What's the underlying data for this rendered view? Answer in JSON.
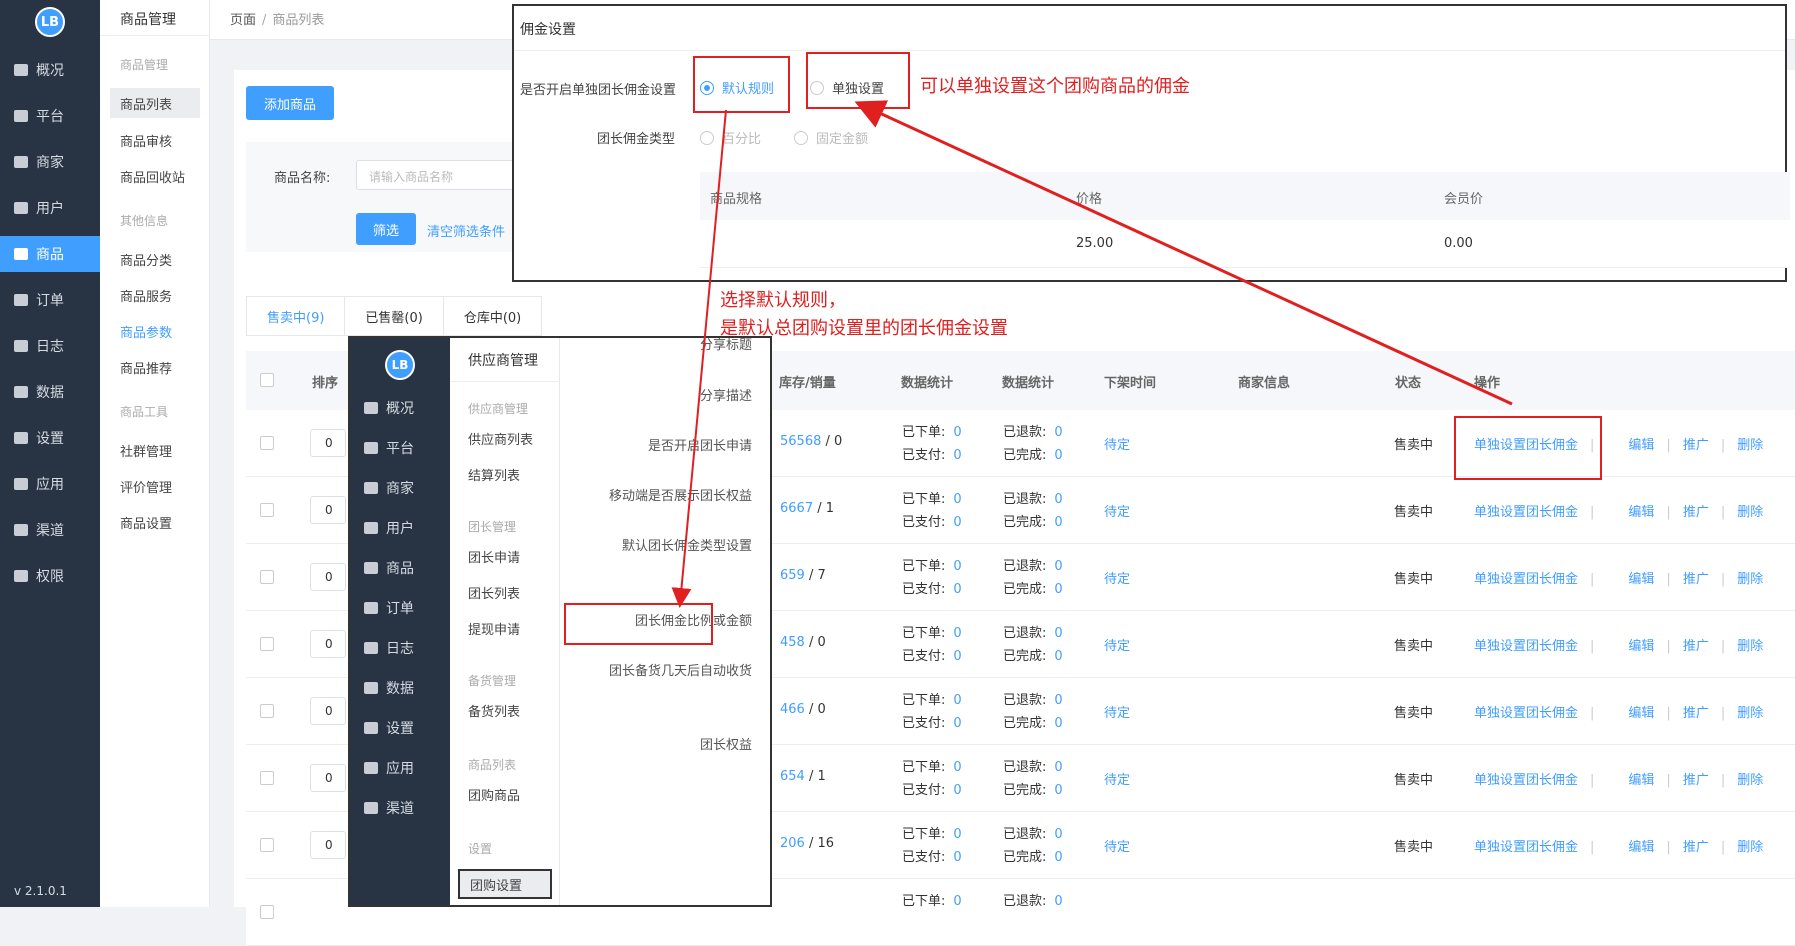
{
  "sidebar": {
    "logo": "LB",
    "items": [
      "概况",
      "平台",
      "商家",
      "用户",
      "商品",
      "订单",
      "日志",
      "数据",
      "设置",
      "应用",
      "渠道",
      "权限"
    ],
    "active_index": 4,
    "version": "v 2.1.0.1"
  },
  "subside": {
    "header": "商品管理",
    "group1": "商品管理",
    "group1_items": [
      "商品列表",
      "商品审核",
      "商品回收站"
    ],
    "group2": "其他信息",
    "group2_items": [
      "商品分类",
      "商品服务",
      "商品参数",
      "商品推荐"
    ],
    "group3": "商品工具",
    "group3_items": [
      "社群管理",
      "评价管理",
      "商品设置"
    ]
  },
  "breadcrumb": {
    "root": "页面",
    "sep": "/",
    "current": "商品列表"
  },
  "toolbar": {
    "add_label": "添加商品"
  },
  "filter": {
    "name_label": "商品名称:",
    "name_placeholder": "请输入商品名称",
    "filter_btn": "筛选",
    "clear": "清空筛选条件"
  },
  "tabs": [
    "售卖中(9)",
    "已售罄(0)",
    "仓库中(0)"
  ],
  "table": {
    "headers": {
      "sort": "排序",
      "stock": "库存/销量",
      "stats1": "数据统计",
      "stats2": "数据统计",
      "offtime": "下架时间",
      "merchant": "商家信息",
      "status": "状态",
      "ops": "操作"
    },
    "stat_labels": {
      "ordered": "已下单:",
      "paid": "已支付:",
      "refunded": "已退款:",
      "done": "已完成:"
    },
    "op_labels": {
      "commission": "单独设置团长佣金",
      "edit": "编辑",
      "promote": "推广",
      "delete": "删除",
      "sep": "|"
    },
    "rows": [
      {
        "sort": "0",
        "stock": "56568",
        "sales": "0",
        "ordered": "0",
        "paid": "0",
        "refunded": "0",
        "done": "0",
        "offtime": "待定",
        "status": "售卖中"
      },
      {
        "sort": "0",
        "stock": "6667",
        "sales": "1",
        "ordered": "0",
        "paid": "0",
        "refunded": "0",
        "done": "0",
        "offtime": "待定",
        "status": "售卖中"
      },
      {
        "sort": "0",
        "stock": "659",
        "sales": "7",
        "ordered": "0",
        "paid": "0",
        "refunded": "0",
        "done": "0",
        "offtime": "待定",
        "status": "售卖中"
      },
      {
        "sort": "0",
        "stock": "458",
        "sales": "0",
        "ordered": "0",
        "paid": "0",
        "refunded": "0",
        "done": "0",
        "offtime": "待定",
        "status": "售卖中"
      },
      {
        "sort": "0",
        "stock": "466",
        "sales": "0",
        "ordered": "0",
        "paid": "0",
        "refunded": "0",
        "done": "0",
        "offtime": "待定",
        "status": "售卖中"
      },
      {
        "sort": "0",
        "stock": "654",
        "sales": "1",
        "ordered": "0",
        "paid": "0",
        "refunded": "0",
        "done": "0",
        "offtime": "待定",
        "status": "售卖中"
      },
      {
        "sort": "0",
        "stock": "206",
        "sales": "16",
        "ordered": "0",
        "paid": "0",
        "refunded": "0",
        "done": "0",
        "offtime": "待定",
        "status": "售卖中"
      }
    ],
    "partial_row": {
      "ordered": "0",
      "refunded": "0"
    }
  },
  "popup_settings": {
    "logo": "LB",
    "nav": [
      "概况",
      "平台",
      "商家",
      "用户",
      "商品",
      "订单",
      "日志",
      "数据",
      "设置",
      "应用",
      "渠道"
    ],
    "sub_header": "供应商管理",
    "groups": [
      {
        "title": "供应商管理",
        "items": [
          "供应商列表",
          "结算列表"
        ]
      },
      {
        "title": "团长管理",
        "items": [
          "团长申请",
          "团长列表",
          "提现申请"
        ]
      },
      {
        "title": "备货管理",
        "items": [
          "备货列表"
        ]
      },
      {
        "title": "商品列表",
        "items": [
          "团购商品"
        ]
      },
      {
        "title": "设置",
        "items": [
          "团购设置"
        ]
      }
    ],
    "form_labels": [
      "分享标题",
      "分享描述",
      "是否开启团长申请",
      "移动端是否展示团长权益",
      "默认团长佣金类型设置",
      "团长佣金比例或金额",
      "团长备货几天后自动收货",
      "团长权益"
    ]
  },
  "popup_commission": {
    "title": "佣金设置",
    "enable_label": "是否开启单独团长佣金设置",
    "opt_default": "默认规则",
    "opt_single": "单独设置",
    "type_label": "团长佣金类型",
    "type_percent": "百分比",
    "type_fixed": "固定金额",
    "table_headers": [
      "商品规格",
      "价格",
      "会员价"
    ],
    "row": {
      "spec": "",
      "price": "25.00",
      "member_price": "0.00"
    }
  },
  "annotations": {
    "single_note": "可以单独设置这个团购商品的佣金",
    "default_note_line1": "选择默认规则，",
    "default_note_line2": "是默认总团购设置里的团长佣金设置"
  },
  "colors": {
    "accent": "#409eff",
    "sidebar": "#283444",
    "annotation": "#e02020"
  }
}
